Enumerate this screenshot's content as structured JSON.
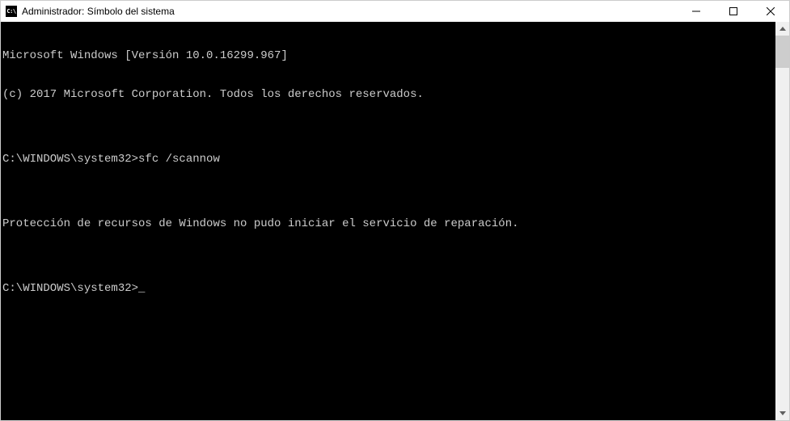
{
  "window": {
    "title": "Administrador: Símbolo del sistema",
    "icon_label": "cmd-icon"
  },
  "console": {
    "lines": [
      "Microsoft Windows [Versión 10.0.16299.967]",
      "(c) 2017 Microsoft Corporation. Todos los derechos reservados.",
      "",
      "C:\\WINDOWS\\system32>sfc /scannow",
      "",
      "Protección de recursos de Windows no pudo iniciar el servicio de reparación.",
      "",
      "C:\\WINDOWS\\system32>"
    ],
    "cursor": "_"
  }
}
